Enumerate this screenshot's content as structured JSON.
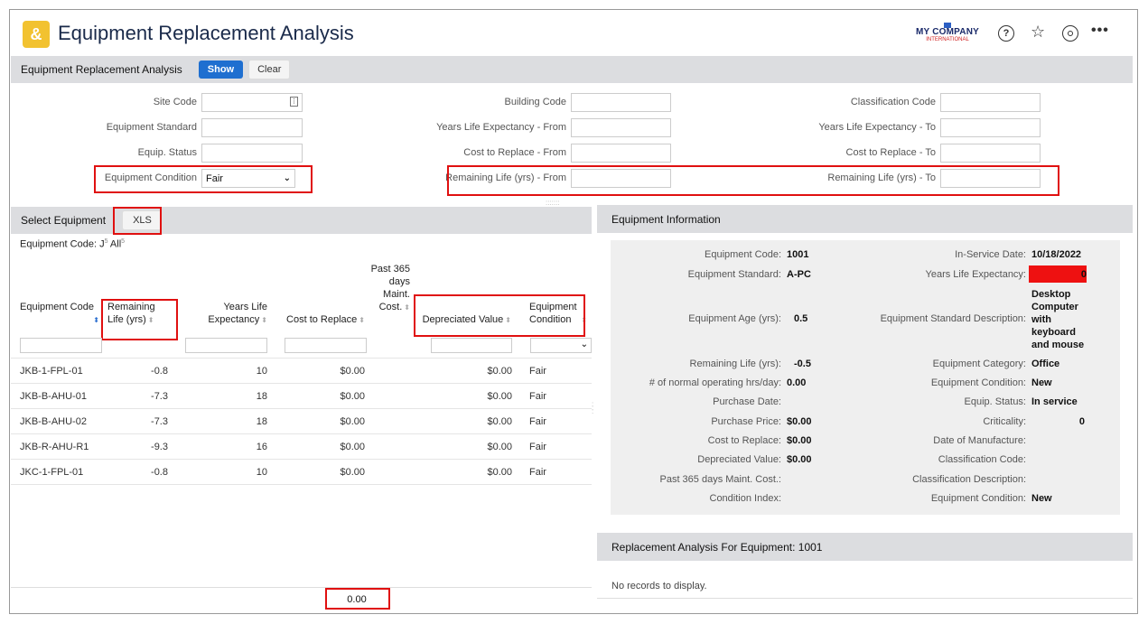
{
  "app": {
    "title": "Equipment Replacement Analysis",
    "logo_glyph": "&",
    "logo_color": "#f2c230",
    "company_line1": "MY COMPANY",
    "company_line2": "INTERNATIONAL",
    "help_icon": "question-circle-icon",
    "favorites_icon": "star-plus-icon",
    "user_icon": "user-circle-icon",
    "more_icon": "more-horizontal-icon",
    "more_glyph": "•••",
    "help_glyph": "?"
  },
  "filter_bar": {
    "title": "Equipment Replacement Analysis",
    "show_label": "Show",
    "clear_label": "Clear",
    "accent": "#1f6fd0"
  },
  "filters": {
    "site_code": {
      "label": "Site Code",
      "value": ""
    },
    "building_code": {
      "label": "Building Code",
      "value": ""
    },
    "classification_code": {
      "label": "Classification Code",
      "value": ""
    },
    "equipment_standard": {
      "label": "Equipment Standard",
      "value": ""
    },
    "years_life_from": {
      "label": "Years Life Expectancy - From",
      "value": ""
    },
    "years_life_to": {
      "label": "Years Life Expectancy - To",
      "value": ""
    },
    "equip_status": {
      "label": "Equip. Status",
      "value": ""
    },
    "cost_from": {
      "label": "Cost to Replace - From",
      "value": ""
    },
    "cost_to": {
      "label": "Cost to Replace - To",
      "value": ""
    },
    "equipment_condition": {
      "label": "Equipment Condition",
      "value": "Fair"
    },
    "remaining_from": {
      "label": "Remaining Life (yrs) - From",
      "value": ""
    },
    "remaining_to": {
      "label": "Remaining Life (yrs) - To",
      "value": ""
    }
  },
  "select_equipment": {
    "title": "Select Equipment",
    "xls_label": "XLS",
    "code_filter_label": "Equipment Code:",
    "code_filter_value": "J",
    "code_filter_count": "5",
    "all_label": "All",
    "all_count": "5",
    "columns": [
      "Equipment Code",
      "Remaining Life (yrs)",
      "Years Life Expectancy",
      "Cost to Replace",
      "Past 365 days Maint. Cost.",
      "Depreciated Value",
      "Equipment Condition"
    ],
    "rows": [
      {
        "code": "JKB-1-FPL-01",
        "remaining": "-0.8",
        "years": "10",
        "cost": "$0.00",
        "maint": "",
        "depreciated": "$0.00",
        "condition": "Fair"
      },
      {
        "code": "JKB-B-AHU-01",
        "remaining": "-7.3",
        "years": "18",
        "cost": "$0.00",
        "maint": "",
        "depreciated": "$0.00",
        "condition": "Fair"
      },
      {
        "code": "JKB-B-AHU-02",
        "remaining": "-7.3",
        "years": "18",
        "cost": "$0.00",
        "maint": "",
        "depreciated": "$0.00",
        "condition": "Fair"
      },
      {
        "code": "JKB-R-AHU-R1",
        "remaining": "-9.3",
        "years": "16",
        "cost": "$0.00",
        "maint": "",
        "depreciated": "$0.00",
        "condition": "Fair"
      },
      {
        "code": "JKC-1-FPL-01",
        "remaining": "-0.8",
        "years": "10",
        "cost": "$0.00",
        "maint": "",
        "depreciated": "$0.00",
        "condition": "Fair"
      }
    ],
    "footer_total": "0.00"
  },
  "equipment_info": {
    "title": "Equipment Information",
    "left": [
      {
        "label": "Equipment Code:",
        "value": "1001"
      },
      {
        "label": "Equipment Standard:",
        "value": "A-PC"
      },
      {
        "label": "Equipment Age (yrs):",
        "value": "0.5"
      },
      {
        "label": "Remaining Life (yrs):",
        "value": "-0.5"
      },
      {
        "label": "# of normal operating hrs/day:",
        "value": "0.00"
      },
      {
        "label": "Purchase Date:",
        "value": ""
      },
      {
        "label": "Purchase Price:",
        "value": "$0.00"
      },
      {
        "label": "Cost to Replace:",
        "value": "$0.00"
      },
      {
        "label": "Depreciated Value:",
        "value": "$0.00"
      },
      {
        "label": "Past 365 days Maint. Cost.:",
        "value": ""
      },
      {
        "label": "Condition Index:",
        "value": ""
      }
    ],
    "right": [
      {
        "label": "In-Service Date:",
        "value": "10/18/2022"
      },
      {
        "label": "Years Life Expectancy:",
        "value": "0"
      },
      {
        "label": "Equipment Standard Description:",
        "value": "Desktop Computer with keyboard and mouse"
      },
      {
        "label": "Equipment Category:",
        "value": "Office"
      },
      {
        "label": "Equipment Condition:",
        "value": "New"
      },
      {
        "label": "Equip. Status:",
        "value": "In service"
      },
      {
        "label": "Criticality:",
        "value": "0"
      },
      {
        "label": "Date of Manufacture:",
        "value": ""
      },
      {
        "label": "Classification Code:",
        "value": ""
      },
      {
        "label": "Classification Description:",
        "value": ""
      },
      {
        "label": "Equipment Condition:",
        "value": "New"
      }
    ],
    "highlight_color": "#ee1111"
  },
  "replacement": {
    "title": "Replacement Analysis For Equipment: 1001",
    "empty_message": "No records to display."
  }
}
